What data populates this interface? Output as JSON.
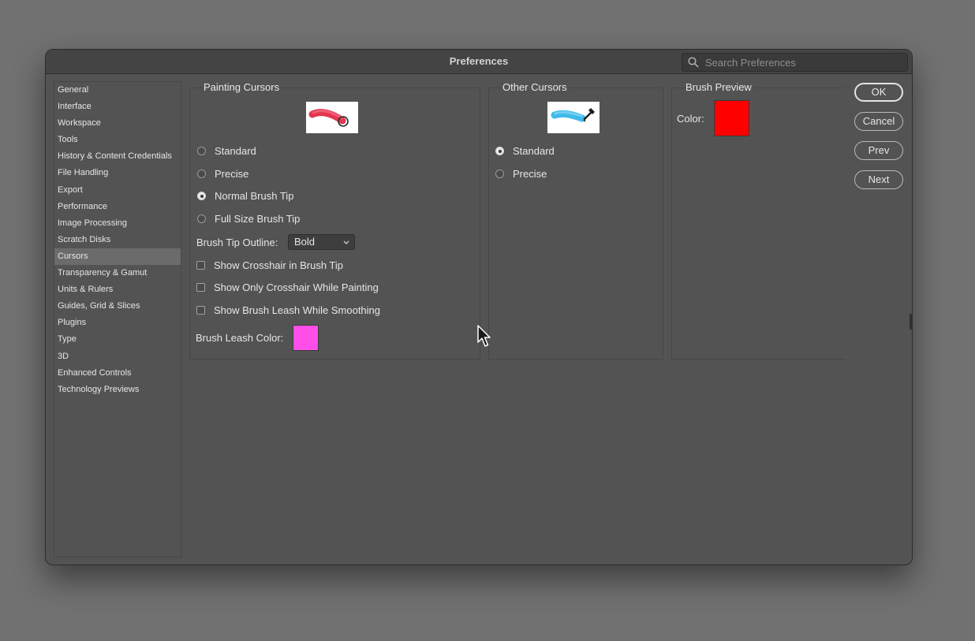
{
  "window": {
    "title": "Preferences",
    "search_placeholder": "Search Preferences"
  },
  "sidebar": {
    "items": [
      {
        "label": "General"
      },
      {
        "label": "Interface"
      },
      {
        "label": "Workspace"
      },
      {
        "label": "Tools"
      },
      {
        "label": "History & Content Credentials"
      },
      {
        "label": "File Handling"
      },
      {
        "label": "Export"
      },
      {
        "label": "Performance"
      },
      {
        "label": "Image Processing"
      },
      {
        "label": "Scratch Disks"
      },
      {
        "label": "Cursors"
      },
      {
        "label": "Transparency & Gamut"
      },
      {
        "label": "Units & Rulers"
      },
      {
        "label": "Guides, Grid & Slices"
      },
      {
        "label": "Plugins"
      },
      {
        "label": "Type"
      },
      {
        "label": "3D"
      },
      {
        "label": "Enhanced Controls"
      },
      {
        "label": "Technology Previews"
      }
    ],
    "selected": "Cursors"
  },
  "painting_cursors": {
    "title": "Painting Cursors",
    "options": [
      "Standard",
      "Precise",
      "Normal Brush Tip",
      "Full Size Brush Tip"
    ],
    "selected": "Normal Brush Tip",
    "brush_tip_outline_label": "Brush Tip Outline:",
    "brush_tip_outline_value": "Bold",
    "checkboxes": [
      {
        "label": "Show Crosshair in Brush Tip",
        "checked": false
      },
      {
        "label": "Show Only Crosshair While Painting",
        "checked": false
      },
      {
        "label": "Show Brush Leash While Smoothing",
        "checked": false
      }
    ],
    "leash_color_label": "Brush Leash Color:",
    "leash_color": "#ff4fe8"
  },
  "other_cursors": {
    "title": "Other Cursors",
    "options": [
      "Standard",
      "Precise"
    ],
    "selected": "Standard"
  },
  "brush_preview": {
    "title": "Brush Preview",
    "color_label": "Color:",
    "color": "#ff0000"
  },
  "buttons": {
    "ok": "OK",
    "cancel": "Cancel",
    "prev": "Prev",
    "next": "Next"
  },
  "icons": {
    "search": "search-icon",
    "chevron": "chevron-down-icon",
    "pointer": "mouse-pointer-icon"
  },
  "colors": {
    "dialog_bg": "#535353",
    "titlebar_bg": "#444444",
    "selected_item_bg": "#6b6b6b",
    "painting_preview_stroke": "#e0203c",
    "other_preview_stroke": "#2ab3e8"
  }
}
